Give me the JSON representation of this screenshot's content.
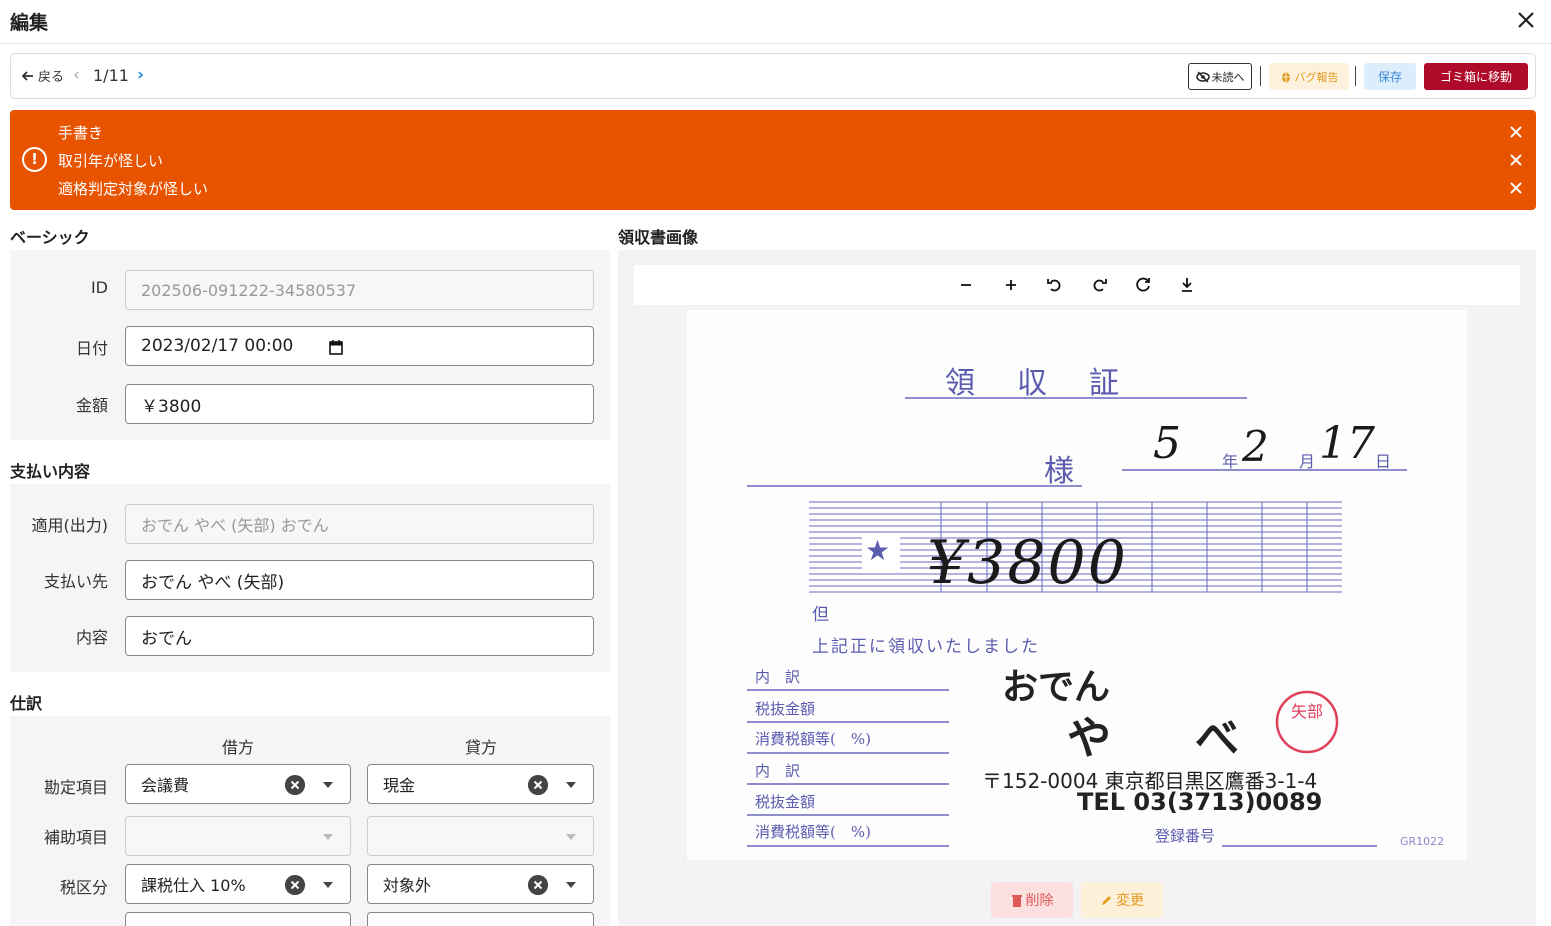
{
  "header": {
    "title": "編集"
  },
  "toolbar": {
    "back_label": "戻る",
    "page_indicator": "1/11",
    "unread_label": "未読へ",
    "bug_label": "バグ報告",
    "save_label": "保存",
    "trash_label": "ゴミ箱に移動"
  },
  "alerts": [
    "手書き",
    "取引年が怪しい",
    "適格判定対象が怪しい"
  ],
  "basic": {
    "section_title": "ベーシック",
    "id_label": "ID",
    "id_value": "202506-091222-34580537",
    "date_label": "日付",
    "date_value": "2023/02/17 00:00",
    "amount_label": "金額",
    "amount_value": "￥3800"
  },
  "payment": {
    "section_title": "支払い内容",
    "summary_label": "適用(出力)",
    "summary_value": "おでん やべ (矢部) おでん",
    "payee_label": "支払い先",
    "payee_value": "おでん やべ (矢部)",
    "content_label": "内容",
    "content_value": "おでん"
  },
  "journal": {
    "section_title": "仕訳",
    "debit_header": "借方",
    "credit_header": "貸方",
    "account_label": "勘定項目",
    "debit_account": "会議費",
    "credit_account": "現金",
    "sub_label": "補助項目",
    "debit_sub": "",
    "credit_sub": "",
    "tax_label": "税区分",
    "debit_tax": "課税仕入 10%",
    "credit_tax": "対象外"
  },
  "receipt_image": {
    "section_title": "領収書画像",
    "delete_label": "削除",
    "change_label": "変更",
    "text": {
      "title": "領　収　証",
      "honorific": "様",
      "date_year": "5",
      "year_char": "年",
      "date_month": "2",
      "month_char": "月",
      "date_day": "17",
      "day_char": "日",
      "amount": "¥3800",
      "tadashi": "但",
      "received": "上記正に領収いたしました",
      "breakdown1": "内　訳",
      "taxexcl1": "税抜金額",
      "taxamt1": "消費税額等(　%)",
      "breakdown2": "内　訳",
      "taxexcl2": "税抜金額",
      "taxamt2": "消費税額等(　%)",
      "shop1": "おでん",
      "shop2": "や　べ",
      "seal": "矢部",
      "address": "〒152-0004 東京都目黒区鷹番3-1-4",
      "tel": "TEL 03(3713)0089",
      "reg_no": "登録番号",
      "code": "GR1022"
    }
  },
  "colors": {
    "alert": "#e85300",
    "trash": "#b00a2a",
    "receipt_ink": "#5b5bb0",
    "seal": "#e0405a"
  }
}
